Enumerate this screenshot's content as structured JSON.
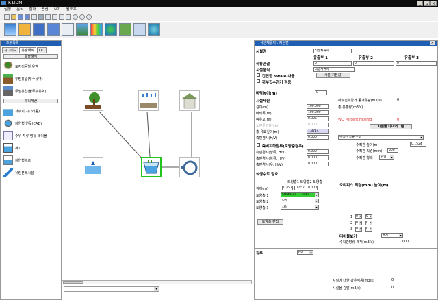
{
  "app": {
    "title": "K-LIDM"
  },
  "window_controls": [
    "_",
    "▫",
    "×"
  ],
  "menu": [
    "설정",
    "분석",
    "결과",
    "옵션",
    "보기",
    "윈도우"
  ],
  "left_panel": {
    "title": "도구목록",
    "tabs": [
      "시나리오",
      "유출해석",
      "LID"
    ],
    "section1": "유출해석",
    "items1": [
      "토지이용별 유역",
      "투방유입(투수유역)",
      "투방유입(불투수유역)"
    ],
    "section2": "수리계산",
    "items2": [
      "저수지(시다리종)",
      "자연형 연못(CAD)",
      "수위-저류-방류 테이블",
      "꺼기",
      "자연형수로",
      "유량분배시설"
    ]
  },
  "right_panel": {
    "title": "식생체류지 : 제원편",
    "facility_name_label": "시설명",
    "facility_name_value": "식생체류지 1",
    "headers": [
      "유출부 1",
      "유출부 2",
      "유출부 3"
    ],
    "downstream_label": "하류연결",
    "downstream_values": [
      "0",
      "0",
      "0"
    ],
    "facility_type_label": "시설형식",
    "facility_type_value": "식생체류지",
    "swale_label": "간단한 Swale 사용",
    "facility_default_btn": "시설(기본값)",
    "bottom_pipe_label": "하부집수관거 적용",
    "depth_label": "바닥높이(m)",
    "depth_value": "0",
    "specs_label": "시설제원",
    "rows": [
      {
        "label": "길이(m)",
        "value": "100.000"
      },
      {
        "label": "바닥폭(m)",
        "value": "100.000"
      },
      {
        "label": "여유고(m)",
        "value": "0.305"
      },
      {
        "label": "노면투과율(cfs)",
        "value": "0.000"
      },
      {
        "label": "총 유효깊이(m)",
        "value": "1.3714"
      },
      {
        "label": "측면경사(H/V)",
        "value": "0.000"
      }
    ],
    "side_infil_label": "측벽지하침투(토양층경우)",
    "side_rows": [
      {
        "label": "측면경사(상류, H/V)",
        "value": "0.000"
      },
      {
        "label": "측면경사(하류, H/V)",
        "value": "0.000"
      },
      {
        "label": "측면경사(우, H/V)",
        "value": "0.000"
      }
    ],
    "right_info1": "하부집수양거 동과유량(m3/s)",
    "right_info1_val": "0",
    "right_info2": "총 유출량(m3/s)",
    "wq_label": "WQ Percent Filtered",
    "wq_val": "0",
    "diagram_btn": "시설물 다이어그램",
    "outlet_type_value": "수직관 방류 구조",
    "riser_height_label": "수직관 높이(m)",
    "riser_height_val": "0.1524",
    "riser_dia_label": "수직관 직경(mm)",
    "riser_dia_val": "500",
    "riser_shape_label": "수직관 형태",
    "riser_shape_val": "원형",
    "soil_section_label": "식생수로 필요",
    "soil_headers": "토양층1 토양층2 토양층",
    "soil_depth_label": "깊이(m)",
    "soil_depths": [
      "0.457",
      "0.457",
      "0.000"
    ],
    "soil_rows": [
      {
        "label": "토양층 1",
        "value": "SMMaFor 12 in/hr"
      },
      {
        "label": "토양층 2",
        "value": "모래"
      },
      {
        "label": "토양층 3",
        "value": "자갈"
      }
    ],
    "soil_edit_btn": "토양층 편집",
    "orifice_label": "오리피스  직경(mm) 높이(m)",
    "orifice_rows": [
      {
        "n": "1",
        "d": "0",
        "h": "0"
      },
      {
        "n": "2",
        "d": "0",
        "h": "0"
      },
      {
        "n": "3",
        "d": "0",
        "h": "0"
      }
    ],
    "table_view_label": "테이블보기",
    "table_view_val": "출기",
    "riser_flow_label": "수직관방류 체적(m3/s)",
    "riser_flow_val": ".000",
    "infil_label": "침투",
    "infil_val": "NO",
    "bottom1_label": "시설에 대한 강우적용(m3/s)",
    "bottom1_val": "0",
    "bottom2_label": "시설을 증발(m3/s)",
    "bottom2_val": "0"
  },
  "colors": {
    "title_bar": "#0c0c0c",
    "panel_title": "#1f5fb3",
    "selected_node": "#22c51b",
    "soil_highlight": "#33cc33",
    "wq_red": "#e03030"
  }
}
